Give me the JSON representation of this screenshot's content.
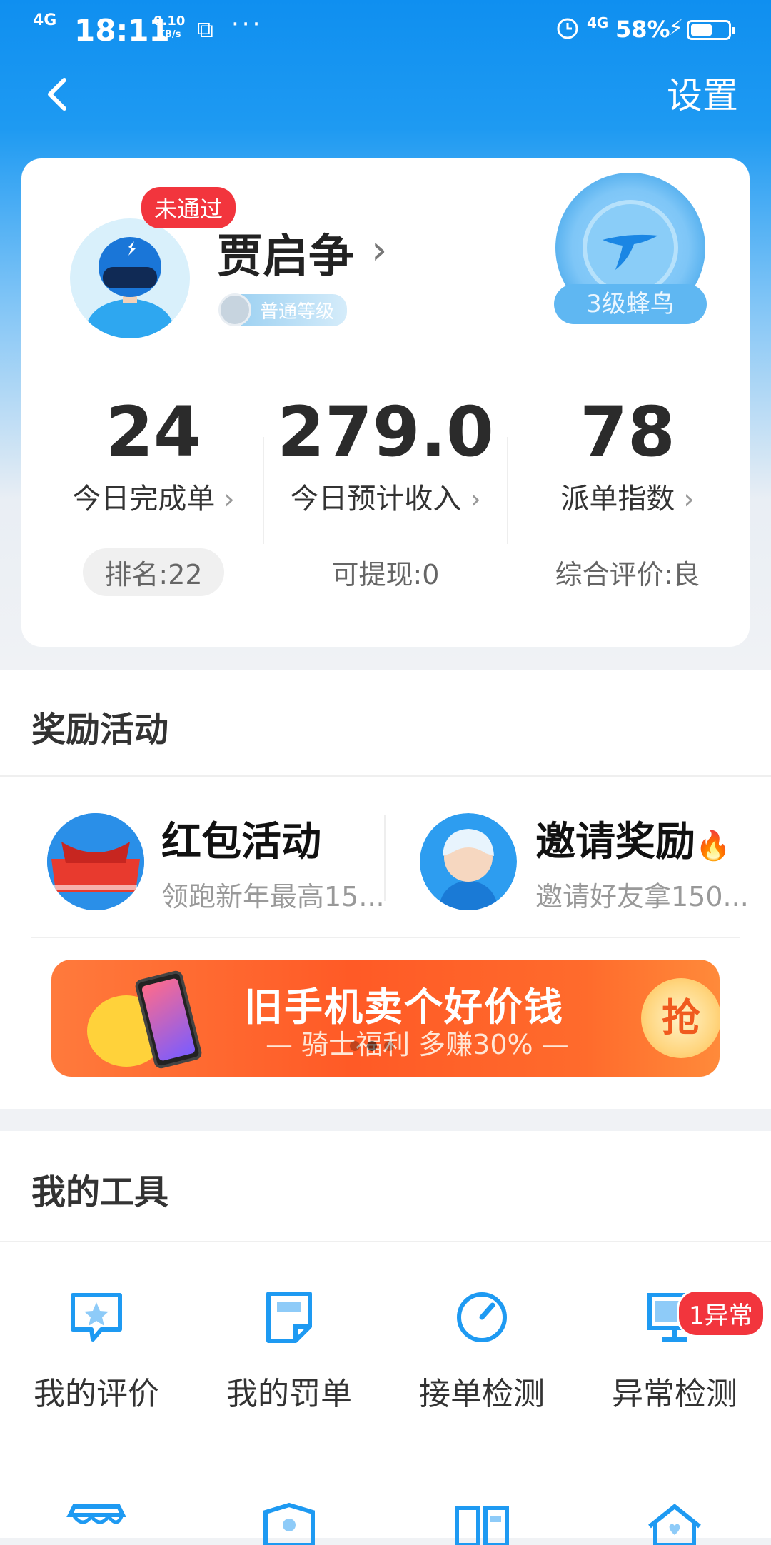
{
  "status_bar": {
    "signal": "4G",
    "time": "18:11",
    "speed_value": "0.10",
    "speed_unit": "KB/s",
    "more": "···",
    "network": "4G",
    "battery": "58%",
    "battery_level": 0.58
  },
  "nav": {
    "settings": "设置"
  },
  "profile": {
    "status_badge": "未通过",
    "name": "贾启争",
    "level": "普通等级",
    "rank": "3级蜂鸟"
  },
  "stats": [
    {
      "value": "24",
      "label": "今日完成单",
      "sub": "排名:22"
    },
    {
      "value": "279.0",
      "label": "今日预计收入",
      "sub": "可提现:0"
    },
    {
      "value": "78",
      "label": "派单指数",
      "sub": "综合评价:良"
    }
  ],
  "rewards": {
    "title": "奖励活动",
    "items": [
      {
        "title": "红包活动",
        "subtitle": "领跑新年最高15..."
      },
      {
        "title": "邀请奖励",
        "subtitle": "邀请好友拿150..."
      }
    ],
    "banner": {
      "headline": "旧手机卖个好价钱",
      "subline": "— 骑士福利 多赚30% —",
      "button": "抢",
      "dots": 3,
      "active_dot": 2
    }
  },
  "tools": {
    "title": "我的工具",
    "items": [
      {
        "label": "我的评价",
        "icon": "review-star-icon"
      },
      {
        "label": "我的罚单",
        "icon": "ticket-note-icon"
      },
      {
        "label": "接单检测",
        "icon": "speed-gauge-icon"
      },
      {
        "label": "异常检测",
        "icon": "monitor-alert-icon",
        "badge": "1异常"
      }
    ]
  },
  "colors": {
    "primary": "#1e9af2",
    "alert": "#f2353d",
    "promo": "#ff5a26"
  }
}
